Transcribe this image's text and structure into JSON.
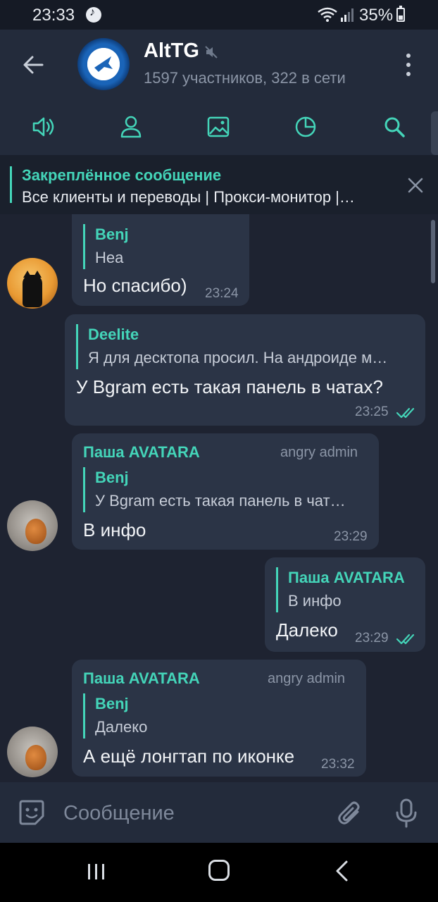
{
  "status_bar": {
    "time": "23:33",
    "battery": "35%"
  },
  "header": {
    "title": "AltTG",
    "subtitle": "1597 участников, 322 в сети"
  },
  "toolbar": [
    "speaker-icon",
    "user-icon",
    "image-icon",
    "pie-chart-icon",
    "search-icon"
  ],
  "pinned": {
    "title": "Закреплённое сообщение",
    "text": "Все клиенты и переводы | Прокси-монитор |…"
  },
  "messages": [
    {
      "sender": "",
      "role": "",
      "reply_name": "Benj",
      "reply_text": "Hea",
      "text": "Но спасибо)",
      "time": "23:24",
      "outgoing": false
    },
    {
      "sender": "",
      "role": "",
      "reply_name": "Deelite",
      "reply_text": "Я для десктопа просил. На андроиде м…",
      "text": "У Bgram есть такая панель в чатах?",
      "time": "23:25",
      "outgoing": true
    },
    {
      "sender": "Паша AVATARA",
      "role": "angry admin",
      "reply_name": "Benj",
      "reply_text": "У Bgram есть такая панель в чат…",
      "text": "В инфо",
      "time": "23:29",
      "outgoing": false
    },
    {
      "sender": "",
      "role": "",
      "reply_name": "Паша AVATARA",
      "reply_text": "В инфо",
      "text": "Далеко",
      "time": "23:29",
      "outgoing": true
    },
    {
      "sender": "Паша AVATARA",
      "role": "angry admin",
      "reply_name": "Benj",
      "reply_text": "Далеко",
      "text": "А ещё лонгтап по иконке",
      "time": "23:32",
      "outgoing": false
    }
  ],
  "composer": {
    "placeholder": "Сообщение"
  },
  "colors": {
    "accent": "#44d5b9",
    "background": "#1e2331",
    "bubble": "#2b3446",
    "header": "#232b3b"
  }
}
